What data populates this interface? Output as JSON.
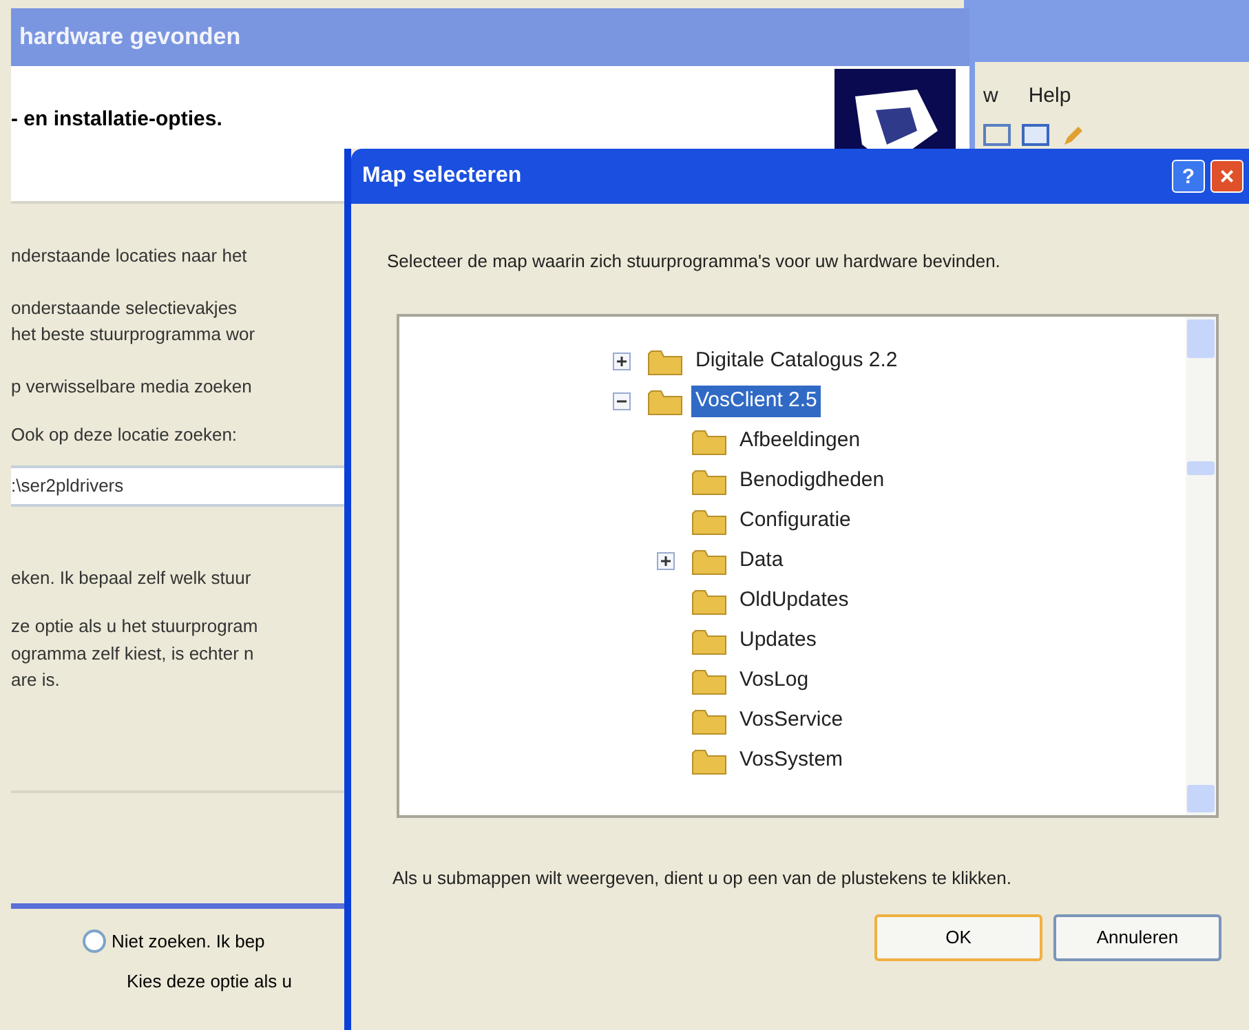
{
  "wizard_window": {
    "title": "hardware gevonden",
    "heading": "- en installatie-opties.",
    "lines": [
      "nderstaande locaties naar het",
      "onderstaande selectievakjes",
      "het beste stuurprogramma wor",
      "p verwisselbare media zoeken",
      "Ook op deze locatie zoeken:"
    ],
    "path_field": ":\\ser2pldrivers",
    "lines_2": [
      "eken. Ik bepaal zelf welk stuur",
      "ze optie als u het stuurprogram",
      "ogramma zelf kiest, is echter n",
      "are is."
    ],
    "radio": {
      "label": "Niet zoeken. Ik bep",
      "selected": false
    },
    "note": "Kies deze optie als u"
  },
  "explorer_window": {
    "menu": [
      "w",
      "Help"
    ]
  },
  "dialog": {
    "title": "Map selecteren",
    "help_button": "?",
    "close_button": "×",
    "description": "Selecteer de map waarin zich stuurprogramma's voor uw hardware bevinden.",
    "tree": [
      {
        "label": "Digitale Catalogus 2.2",
        "expanded": false,
        "selected": false
      },
      {
        "label": "VosClient 2.5",
        "expanded": true,
        "selected": true,
        "children": [
          {
            "label": "Afbeeldingen",
            "selected": false
          },
          {
            "label": "Benodigdheden",
            "selected": false
          },
          {
            "label": "Configuratie",
            "selected": false
          },
          {
            "label": "Data",
            "expanded": false,
            "selected": false
          },
          {
            "label": "OldUpdates",
            "selected": false
          },
          {
            "label": "Updates",
            "selected": false
          },
          {
            "label": "VosLog",
            "selected": false
          },
          {
            "label": "VosService",
            "selected": false
          },
          {
            "label": "VosSystem",
            "selected": false
          }
        ]
      }
    ],
    "hint": "Als u submappen wilt weergeven, dient u op een van de plustekens te klikken.",
    "buttons": [
      {
        "label": "OK",
        "default": true
      },
      {
        "label": "Annuleren",
        "default": false
      }
    ]
  }
}
